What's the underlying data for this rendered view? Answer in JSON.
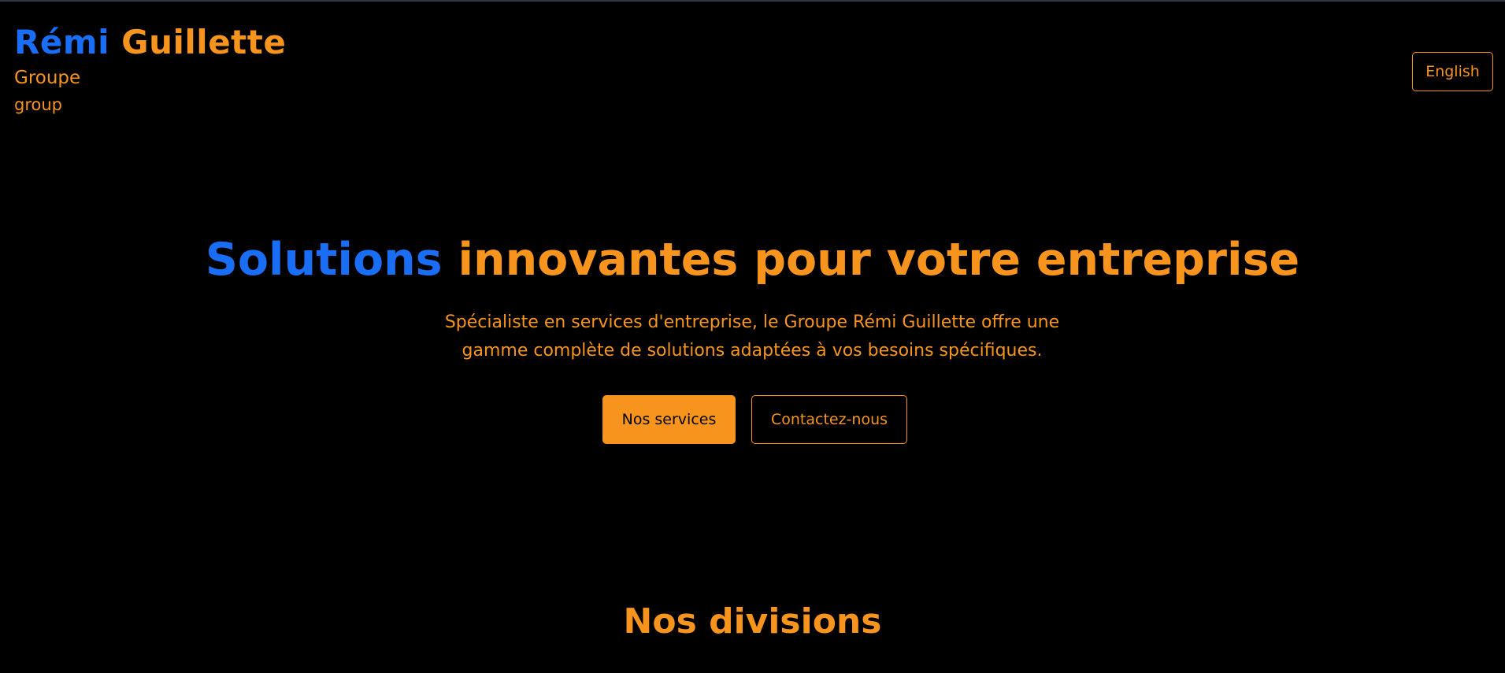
{
  "colors": {
    "background": "#000000",
    "accent_blue": "#1a6ef5",
    "accent_orange": "#f7941d"
  },
  "header": {
    "brand_first": "Rémi",
    "brand_last": "Guillette",
    "brand_sub1": "Groupe",
    "brand_sub2": "group",
    "language_button": "English"
  },
  "hero": {
    "title_highlight": "Solutions",
    "title_rest": "innovantes pour votre entreprise",
    "description": "Spécialiste en services d'entreprise, le Groupe Rémi Guillette offre une gamme complète de solutions adaptées à vos besoins spécifiques.",
    "primary_button": "Nos services",
    "secondary_button": "Contactez-nous"
  },
  "divisions": {
    "title": "Nos divisions"
  }
}
